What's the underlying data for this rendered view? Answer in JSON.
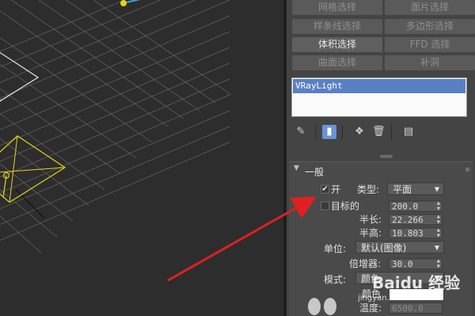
{
  "modifier_buttons": [
    {
      "label": "网格选择",
      "active": false
    },
    {
      "label": "面片选择",
      "active": false
    },
    {
      "label": "样条线选择",
      "active": false
    },
    {
      "label": "多边形选择",
      "active": false
    },
    {
      "label": "体积选择",
      "active": true
    },
    {
      "label": "FFD 选择",
      "active": false
    },
    {
      "label": "曲面选择",
      "active": false
    },
    {
      "label": "补洞",
      "active": false
    }
  ],
  "modifier_stack": {
    "selected_item": "VRayLight"
  },
  "toolbar_icons": [
    "pin-stack-icon",
    "show-end-result-icon",
    "make-unique-icon",
    "remove-modifier-icon",
    "configure-modifier-sets-icon"
  ],
  "rollout": {
    "title": "一般",
    "on": {
      "label": "开",
      "checked": true
    },
    "type": {
      "label": "类型:",
      "value": "平面"
    },
    "targeted": {
      "label": "目标的",
      "checked": false,
      "value": "200.0"
    },
    "half_length": {
      "label": "半长:",
      "value": "22.266"
    },
    "half_height": {
      "label": "半高:",
      "value": "10.803"
    },
    "units": {
      "label": "单位:",
      "value": "默认(图像)"
    },
    "multiplier": {
      "label": "倍增器:",
      "value": "30.0"
    },
    "mode": {
      "label": "模式:",
      "value": "颜色"
    },
    "color": {
      "label": "颜色"
    },
    "temperature": {
      "label": "温度:",
      "value": "6500.0"
    }
  },
  "watermark": {
    "logo": "Baidu 经验",
    "url": "jingyan.baidu.com"
  },
  "colors": {
    "arrow": "#e02020",
    "light_gizmo": "#e8d21a",
    "grid": "#6a6a6a",
    "selection": "#5a7fc4"
  }
}
